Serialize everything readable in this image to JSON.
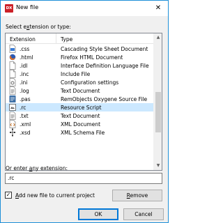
{
  "window": {
    "app_icon_text": "DX",
    "title": "New file",
    "close_glyph": "✕"
  },
  "list": {
    "label_prefix": "Select e",
    "label_accel": "x",
    "label_suffix": "tension or type:",
    "columns": {
      "extension": "Extension",
      "type": "Type"
    },
    "rows": [
      {
        "ext": ".css",
        "type": "Cascading Style Sheet Document",
        "icon": "css-file-icon",
        "selected": false
      },
      {
        "ext": ".html",
        "type": "Firefox HTML Document",
        "icon": "firefox-icon",
        "selected": false
      },
      {
        "ext": ".idl",
        "type": "Interface Definition Language File",
        "icon": "document-icon",
        "selected": false
      },
      {
        "ext": ".inc",
        "type": "Include File",
        "icon": "document-icon",
        "selected": false
      },
      {
        "ext": ".ini",
        "type": "Configuration settings",
        "icon": "settings-file-icon",
        "selected": false
      },
      {
        "ext": ".log",
        "type": "Text Document",
        "icon": "text-file-icon",
        "selected": false
      },
      {
        "ext": ".pas",
        "type": "RemObjects Oxygene Source File",
        "icon": "pas-file-icon",
        "selected": false
      },
      {
        "ext": ".rc",
        "type": "Resource Script",
        "icon": "resource-file-icon",
        "selected": true
      },
      {
        "ext": ".txt",
        "type": "Text Document",
        "icon": "text-file-icon",
        "selected": false
      },
      {
        "ext": ".xml",
        "type": "XML Document",
        "icon": "xml-file-icon",
        "selected": false
      },
      {
        "ext": ".xsd",
        "type": "XML Schema File",
        "icon": "xsd-file-icon",
        "selected": false
      }
    ],
    "scroll_up": "▲",
    "scroll_down": "▼"
  },
  "extension_input": {
    "label_prefix": "Or enter ",
    "label_accel": "a",
    "label_suffix": "ny extension:",
    "value": ".rc"
  },
  "add_to_project": {
    "checked": true,
    "check_glyph": "✓",
    "label_accel": "A",
    "label_suffix": "dd new file to current project"
  },
  "buttons": {
    "remove_accel": "R",
    "remove_suffix": "emove",
    "ok": "OK",
    "cancel": "Cancel"
  },
  "colors": {
    "selection": "#cce8ff",
    "accent_border": "#0078d7",
    "window_border": "#1e8fd8",
    "app_icon": "#cc2027"
  }
}
